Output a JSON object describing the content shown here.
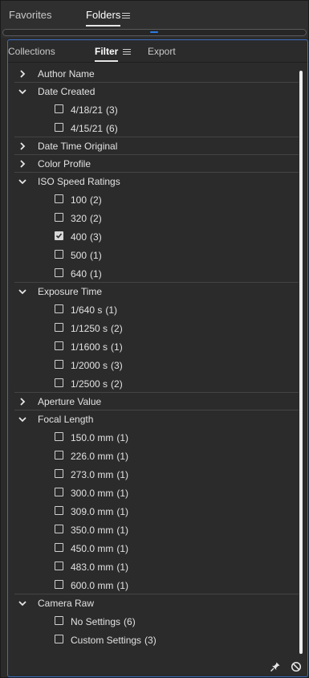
{
  "top_tabs": [
    {
      "label": "Favorites"
    },
    {
      "label": "Folders"
    }
  ],
  "sub_tabs": [
    {
      "label": "Collections"
    },
    {
      "label": "Filter"
    },
    {
      "label": "Export"
    }
  ],
  "filters": {
    "author_name": {
      "label": "Author Name"
    },
    "date_created": {
      "label": "Date Created",
      "items": [
        {
          "label": "4/18/21",
          "count": "(3)",
          "checked": false
        },
        {
          "label": "4/15/21",
          "count": "(6)",
          "checked": false
        }
      ]
    },
    "date_time_original": {
      "label": "Date Time Original"
    },
    "color_profile": {
      "label": "Color Profile"
    },
    "iso_speed_ratings": {
      "label": "ISO Speed Ratings",
      "items": [
        {
          "label": "100",
          "count": "(2)",
          "checked": false
        },
        {
          "label": "320",
          "count": "(2)",
          "checked": false
        },
        {
          "label": "400",
          "count": "(3)",
          "checked": true
        },
        {
          "label": "500",
          "count": "(1)",
          "checked": false
        },
        {
          "label": "640",
          "count": "(1)",
          "checked": false
        }
      ]
    },
    "exposure_time": {
      "label": "Exposure Time",
      "items": [
        {
          "label": "1/640 s",
          "count": "(1)",
          "checked": false
        },
        {
          "label": "1/1250 s",
          "count": "(2)",
          "checked": false
        },
        {
          "label": "1/1600 s",
          "count": "(1)",
          "checked": false
        },
        {
          "label": "1/2000 s",
          "count": "(3)",
          "checked": false
        },
        {
          "label": "1/2500 s",
          "count": "(2)",
          "checked": false
        }
      ]
    },
    "aperture_value": {
      "label": "Aperture Value"
    },
    "focal_length": {
      "label": "Focal Length",
      "items": [
        {
          "label": "150.0 mm",
          "count": "(1)",
          "checked": false
        },
        {
          "label": "226.0 mm",
          "count": "(1)",
          "checked": false
        },
        {
          "label": "273.0 mm",
          "count": "(1)",
          "checked": false
        },
        {
          "label": "300.0 mm",
          "count": "(1)",
          "checked": false
        },
        {
          "label": "309.0 mm",
          "count": "(1)",
          "checked": false
        },
        {
          "label": "350.0 mm",
          "count": "(1)",
          "checked": false
        },
        {
          "label": "450.0 mm",
          "count": "(1)",
          "checked": false
        },
        {
          "label": "483.0 mm",
          "count": "(1)",
          "checked": false
        },
        {
          "label": "600.0 mm",
          "count": "(1)",
          "checked": false
        }
      ]
    },
    "camera_raw": {
      "label": "Camera Raw",
      "items": [
        {
          "label": "No Settings",
          "count": "(6)",
          "checked": false
        },
        {
          "label": "Custom Settings",
          "count": "(3)",
          "checked": false
        }
      ]
    }
  },
  "footer": {
    "pin_icon": "pin-icon",
    "clear_icon": "no-entry-icon"
  },
  "colors": {
    "panel_bg": "#2b2b2b",
    "focus_border": "#3a6fbf",
    "text": "#e2e2e2"
  }
}
